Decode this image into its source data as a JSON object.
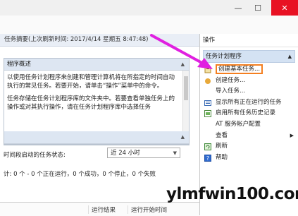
{
  "window": {
    "minimize_glyph": "—",
    "maximize_glyph": "☐",
    "close_glyph": "✕"
  },
  "summary": {
    "text": "任务摘要(上次刷新时间: 2017/4/14 星期五 8:47:48)"
  },
  "overview": {
    "title": "程序概述",
    "paragraphs": [
      "以使用任务计划程序来创建和管理计算机将在所指定的时间自动执行的常见任务。若要开始，请单击“操作”菜单中的命令。",
      "任务存储在任务计划程序库的文件夹中。若要查看单独任务上的操作或对其执行操作，请在任务计划程序库中选择任务"
    ]
  },
  "status": {
    "period_label": "时间段启动的任务状态:",
    "period_value": "近 24 小时",
    "summary": "计: 0 个 - 0 个正在运行，0 个成功，0 个停止，0 个失败"
  },
  "grid": {
    "col_result": "运行结果",
    "col_start": "运行开始时间"
  },
  "actions_panel": {
    "title": "操作",
    "group": "任务计划程序",
    "items": [
      {
        "label": "创建基本任务...",
        "icon": "basic-task-icon",
        "highlight": true
      },
      {
        "label": "创建任务...",
        "icon": "create-task-icon"
      },
      {
        "label": "导入任务...",
        "icon": "import-icon"
      },
      {
        "label": "显示所有正在运行的任务",
        "icon": "running-tasks-icon"
      },
      {
        "label": "启用所有任务历史记录",
        "icon": "history-icon"
      },
      {
        "label": "AT 服务帐户配置",
        "icon": "none"
      },
      {
        "label": "查看",
        "icon": "none",
        "submenu": true
      },
      {
        "label": "刷新",
        "icon": "refresh-icon"
      },
      {
        "label": "帮助",
        "icon": "help-icon"
      }
    ]
  },
  "watermark": "ylmfwin100.com",
  "colors": {
    "accent_highlight": "#f47f20",
    "arrow": "#e020e0",
    "close_button": "#e81123"
  }
}
